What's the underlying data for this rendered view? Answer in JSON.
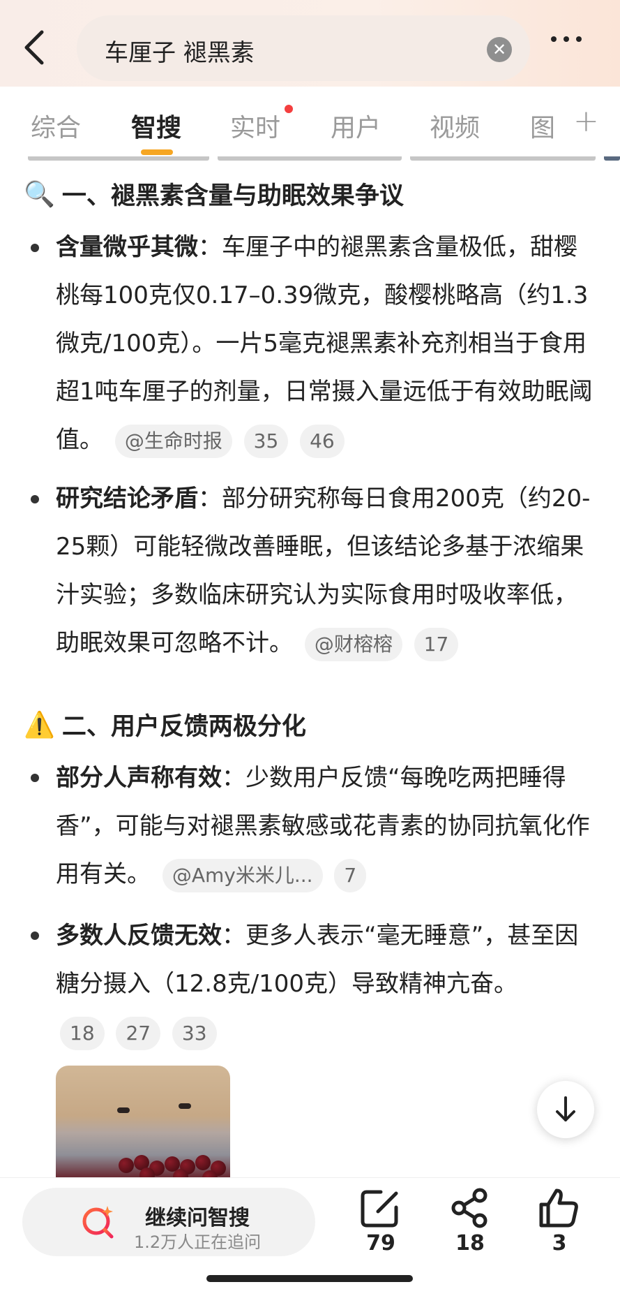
{
  "search": {
    "query": "车厘子 褪黑素"
  },
  "tabs": [
    "综合",
    "智搜",
    "实时",
    "用户",
    "视频",
    "图"
  ],
  "sections": [
    {
      "emoji": "🔍",
      "title": "一、褪黑素含量与助眠效果争议",
      "items": [
        {
          "bold": "含量微乎其微",
          "text": "：车厘子中的褪黑素含量极低，甜樱桃每100克仅0.17–0.39微克，酸樱桃略高（约1.3微克/100克）。一片5毫克褪黑素补充剂相当于食用超1吨车厘子的剂量，日常摄入量远低于有效助眠阈值。",
          "chips": [
            "@生命时报",
            "35",
            "46"
          ]
        },
        {
          "bold": "研究结论矛盾",
          "text": "：部分研究称每日食用200克（约20-25颗）可能轻微改善睡眠，但该结论多基于浓缩果汁实验；多数临床研究认为实际食用时吸收率低，助眠效果可忽略不计。",
          "chips": [
            "@财榕榕",
            "17"
          ]
        }
      ]
    },
    {
      "emoji": "⚠️",
      "title": "二、用户反馈两极分化",
      "items": [
        {
          "bold": "部分人声称有效",
          "text": "：少数用户反馈“每晚吃两把睡得香”，可能与对褪黑素敏感或花青素的协同抗氧化作用有关。",
          "chips": [
            "@Amy米米儿...",
            "7"
          ]
        },
        {
          "bold": "多数人反馈无效",
          "text": "：更多人表示“毫无睡意”，甚至因糖分摄入（12.8克/100克）导致精神亢奋。",
          "chips": [
            "18",
            "27",
            "33"
          ]
        }
      ]
    }
  ],
  "bottom": {
    "ask_title": "继续问智搜",
    "ask_sub": "1.2万人正在追问",
    "comment_count": "79",
    "share_count": "18",
    "like_count": "3"
  }
}
